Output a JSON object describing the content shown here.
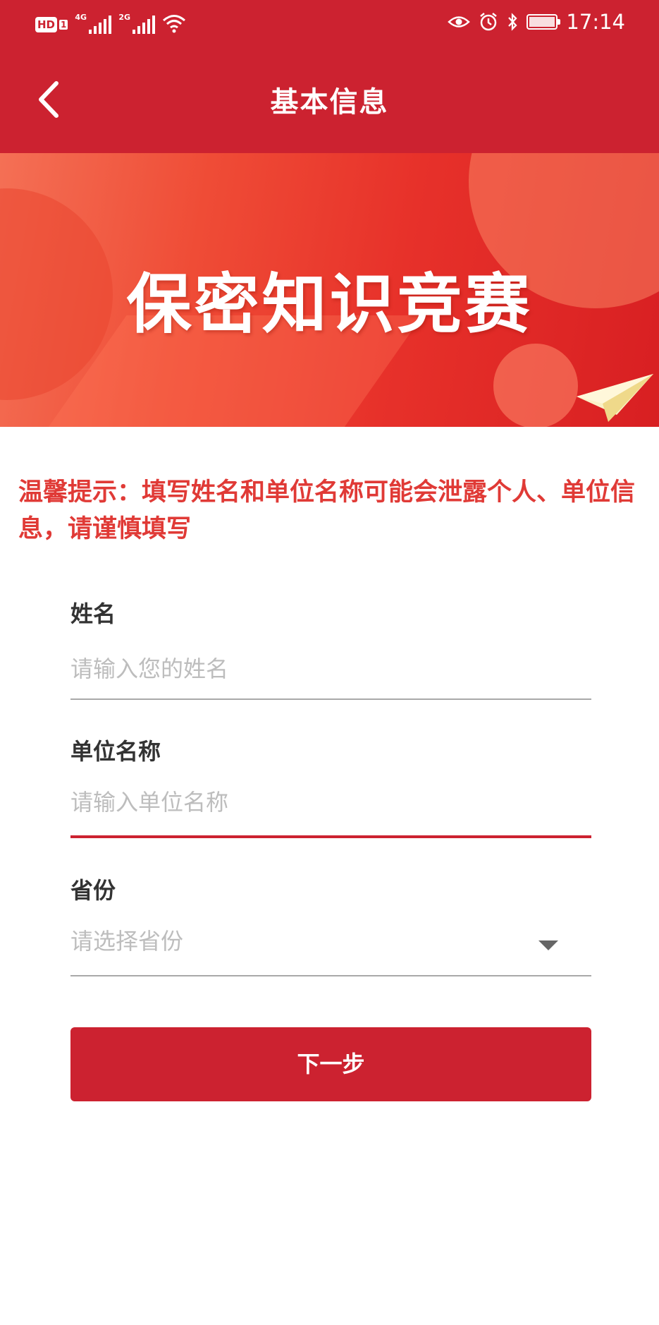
{
  "status_bar": {
    "network_left": "4G",
    "network_right": "2G",
    "time": "17:14"
  },
  "header": {
    "title": "基本信息"
  },
  "banner": {
    "heading": "保密知识竞赛"
  },
  "notice": {
    "text": "温馨提示：填写姓名和单位名称可能会泄露个人、单位信息，请谨慎填写"
  },
  "form": {
    "name": {
      "label": "姓名",
      "placeholder": "请输入您的姓名"
    },
    "org": {
      "label": "单位名称",
      "placeholder": "请输入单位名称"
    },
    "province": {
      "label": "省份",
      "placeholder": "请选择省份"
    }
  },
  "actions": {
    "next_label": "下一步"
  },
  "colors": {
    "brand": "#cc2230",
    "notice": "#e03a36",
    "placeholder": "#bdbdbd"
  }
}
